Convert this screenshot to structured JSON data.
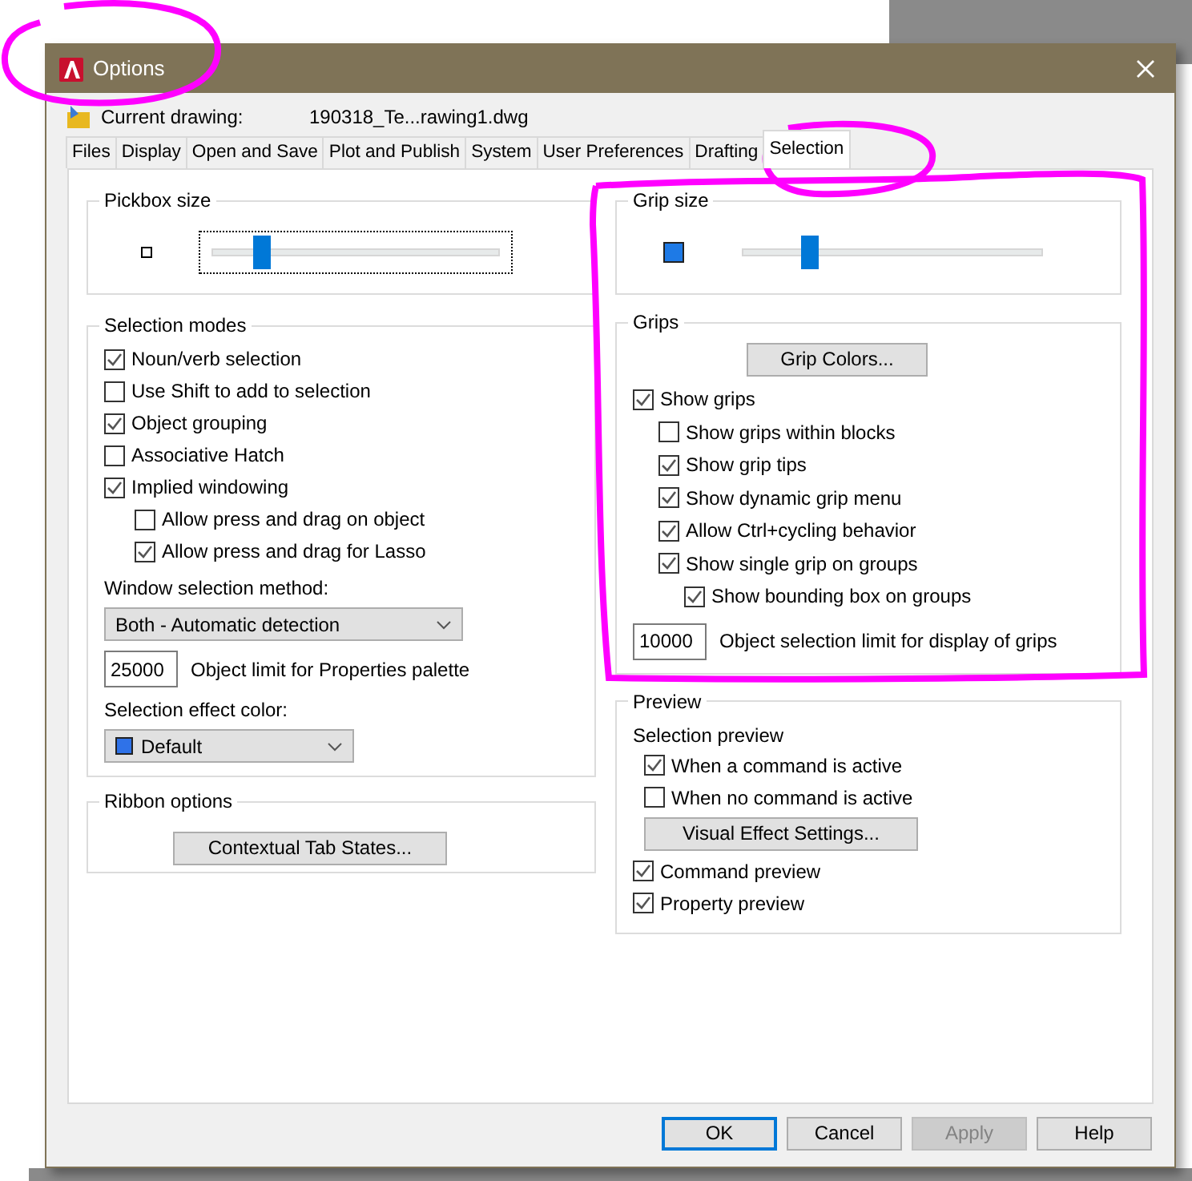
{
  "window": {
    "title": "Options"
  },
  "current_drawing": {
    "label": "Current drawing:",
    "value": "190318_Te...rawing1.dwg"
  },
  "tabs": [
    {
      "label": "Files",
      "selected": false
    },
    {
      "label": "Display",
      "selected": false
    },
    {
      "label": "Open and Save",
      "selected": false
    },
    {
      "label": "Plot and Publish",
      "selected": false
    },
    {
      "label": "System",
      "selected": false
    },
    {
      "label": "User Preferences",
      "selected": false
    },
    {
      "label": "Drafting",
      "selected": false
    },
    {
      "label": "Selection",
      "selected": true
    }
  ],
  "pickbox_size": {
    "title": "Pickbox size",
    "level": 0.17
  },
  "selection_modes": {
    "title": "Selection modes",
    "options": [
      {
        "label": "Noun/verb selection",
        "checked": true
      },
      {
        "label": "Use Shift to add to selection",
        "checked": false
      },
      {
        "label": "Object grouping",
        "checked": true
      },
      {
        "label": "Associative Hatch",
        "checked": false
      },
      {
        "label": "Implied windowing",
        "checked": true,
        "children": [
          {
            "label": "Allow press and drag on object",
            "checked": false
          },
          {
            "label": "Allow press and drag for Lasso",
            "checked": true
          }
        ]
      }
    ],
    "window_selection_method": {
      "label": "Window selection method:",
      "value": "Both - Automatic detection"
    },
    "object_limit": {
      "value": "25000",
      "label": "Object limit for Properties palette"
    },
    "selection_effect_color": {
      "label": "Selection effect color:",
      "value": "Default",
      "color": "#2f72e8"
    }
  },
  "ribbon_options": {
    "title": "Ribbon options",
    "button": "Contextual Tab States..."
  },
  "grip_size": {
    "title": "Grip size",
    "level": 0.22
  },
  "grips": {
    "title": "Grips",
    "button": "Grip Colors...",
    "options": [
      {
        "label": "Show grips",
        "checked": true,
        "children": [
          {
            "label": "Show grips within blocks",
            "checked": false
          },
          {
            "label": "Show grip tips",
            "checked": true
          },
          {
            "label": "Show dynamic grip menu",
            "checked": true
          },
          {
            "label": "Allow Ctrl+cycling behavior",
            "checked": true
          },
          {
            "label": "Show single grip on groups",
            "checked": true,
            "children": [
              {
                "label": "Show bounding box on groups",
                "checked": true
              }
            ]
          }
        ]
      }
    ],
    "limit": {
      "value": "10000",
      "label": "Object selection limit for display of grips"
    }
  },
  "preview": {
    "title": "Preview",
    "selection_preview": {
      "label": "Selection preview",
      "options": [
        {
          "label": "When a command is active",
          "checked": true
        },
        {
          "label": "When no command is active",
          "checked": false
        }
      ]
    },
    "button": "Visual Effect Settings...",
    "options": [
      {
        "label": "Command preview",
        "checked": true
      },
      {
        "label": "Property preview",
        "checked": true
      }
    ]
  },
  "buttons": [
    {
      "label": "OK",
      "default": true,
      "disabled": false
    },
    {
      "label": "Cancel",
      "default": false,
      "disabled": false
    },
    {
      "label": "Apply",
      "default": false,
      "disabled": true
    },
    {
      "label": "Help",
      "default": false,
      "disabled": false
    }
  ]
}
